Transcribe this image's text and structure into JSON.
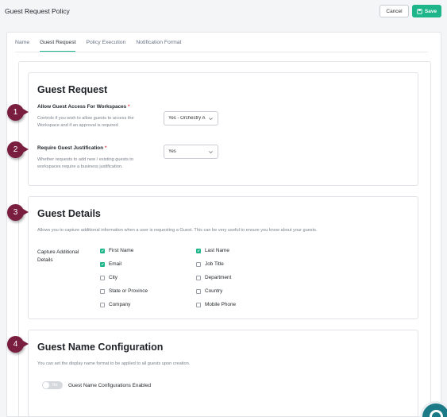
{
  "header": {
    "title": "Guest Request Policy",
    "cancel_label": "Cancel",
    "save_label": "Save"
  },
  "tabs": [
    {
      "label": "Name"
    },
    {
      "label": "Guest Request"
    },
    {
      "label": "Policy Execution"
    },
    {
      "label": "Notification Format"
    }
  ],
  "guest_request": {
    "title": "Guest Request",
    "allow": {
      "label": "Allow Guest Access For Workspaces",
      "required_mark": "*",
      "help_line1": "Controls if you wish to allow guests to access the",
      "help_line2": "Workspace and if an approval is required",
      "value": "Yes - Orchestry A"
    },
    "justification": {
      "label": "Require Guest Justification",
      "required_mark": "*",
      "help_line1": "Whether requests to add new / existing guests to",
      "help_line2": "workspaces require a business justification.",
      "value": "Yes"
    }
  },
  "guest_details": {
    "title": "Guest Details",
    "description": "Allows you to capture additional information when a user is requesting a Guest. This can be very useful to ensure you know about your guests.",
    "capture_label_line1": "Capture Additional",
    "capture_label_line2": "Details",
    "fields": [
      {
        "label": "First Name",
        "checked": true
      },
      {
        "label": "Last Name",
        "checked": true
      },
      {
        "label": "Email",
        "checked": true
      },
      {
        "label": "Job Title",
        "checked": false
      },
      {
        "label": "City",
        "checked": false
      },
      {
        "label": "Department",
        "checked": false
      },
      {
        "label": "State or Province",
        "checked": false
      },
      {
        "label": "Country",
        "checked": false
      },
      {
        "label": "Company",
        "checked": false
      },
      {
        "label": "Mobile Phone",
        "checked": false
      }
    ]
  },
  "guest_name": {
    "title": "Guest Name Configuration",
    "description": "You can set the display name format to be applied to all guests upon creation.",
    "toggle_state_text": "No",
    "toggle_on": false,
    "toggle_label": "Guest Name Configurations Enabled"
  },
  "callouts": [
    "1",
    "2",
    "3",
    "4"
  ],
  "colors": {
    "accent": "#1db589",
    "callout": "#7a1e3f",
    "required": "#e5484d",
    "help_widget": "#1c7a86"
  },
  "icons": {
    "save": "save-icon",
    "select_chevron": "chevron-down-icon",
    "checkbox_mark": "check-icon",
    "help_widget": "help-widget-icon"
  }
}
